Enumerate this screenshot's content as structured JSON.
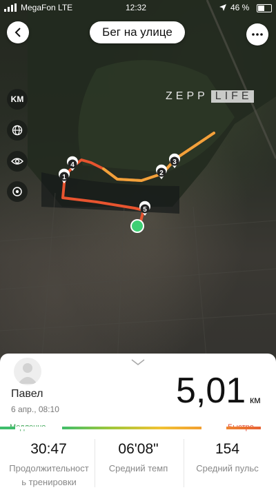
{
  "statusbar": {
    "carrier": "MegaFon  LTE",
    "time": "12:32",
    "battery": "46 %"
  },
  "header": {
    "title": "Бег на улице",
    "back_icon": "back-arrow-icon",
    "more_icon": "more-dots-icon"
  },
  "map": {
    "watermark_a": "ZEPP",
    "watermark_b": "LIFE",
    "unit_toggle": "KM",
    "markers": [
      "1",
      "2",
      "3",
      "4",
      "5"
    ],
    "route_colors": {
      "slow": "#e8542f",
      "mid": "#f2a13a",
      "fast": "#f26a2e"
    },
    "start_color": "#3ecf74"
  },
  "summary": {
    "user_name": "Павел",
    "date": "6 апр., 08:10",
    "distance": "5,01",
    "distance_unit": "км",
    "pace_scale": {
      "slow_label": "Медленно",
      "fast_label": "Быстро"
    },
    "stats": [
      {
        "value": "30:47",
        "label": "Продолжительность тренировки"
      },
      {
        "value": "06'08\"",
        "label": "Средний темп"
      },
      {
        "value": "154",
        "label": "Средний пульс"
      }
    ]
  }
}
